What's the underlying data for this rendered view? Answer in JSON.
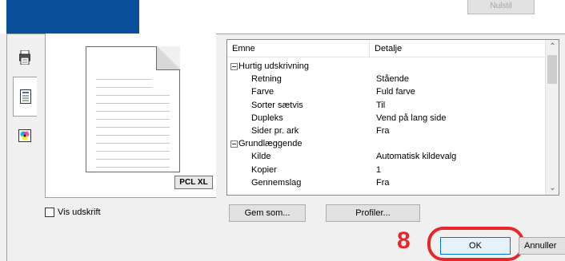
{
  "top": {
    "reset_button": "Nulstil"
  },
  "tabs": [
    {
      "icon": "printer-icon"
    },
    {
      "icon": "document-icon"
    },
    {
      "icon": "color-icon"
    }
  ],
  "preview": {
    "badge": "PCL XL"
  },
  "options": {
    "show_print_label": "Vis udskrift"
  },
  "grid": {
    "columns": [
      "Emne",
      "Detalje"
    ],
    "rows": [
      {
        "type": "group",
        "item": "Hurtig udskrivning",
        "detail": ""
      },
      {
        "type": "item",
        "item": "Retning",
        "detail": "Stående"
      },
      {
        "type": "item",
        "item": "Farve",
        "detail": "Fuld farve"
      },
      {
        "type": "item",
        "item": "Sorter sætvis",
        "detail": "Til"
      },
      {
        "type": "item",
        "item": "Dupleks",
        "detail": "Vend på lang side"
      },
      {
        "type": "item",
        "item": "Sider pr. ark",
        "detail": "Fra"
      },
      {
        "type": "group",
        "item": "Grundlæggende",
        "detail": ""
      },
      {
        "type": "item",
        "item": "Kilde",
        "detail": "Automatisk kildevalg"
      },
      {
        "type": "item",
        "item": "Kopier",
        "detail": "1"
      },
      {
        "type": "item",
        "item": "Gennemslag",
        "detail": "Fra"
      }
    ]
  },
  "buttons": {
    "save_as": "Gem som...",
    "profiles": "Profiler...",
    "ok": "OK",
    "cancel": "Annuller"
  },
  "annotation": {
    "step": "8",
    "accent_color": "#e8262a"
  }
}
